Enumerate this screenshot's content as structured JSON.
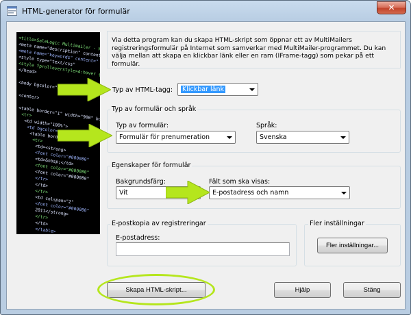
{
  "window": {
    "title": "HTML-generator för formulär",
    "close_label": "✕"
  },
  "side_image": {
    "code_lines": [
      "<title>SaleLogic Multimailer - Newsletter",
      "<meta name=\"description\" content=\"",
      "<meta name=\"keywords\" content=\"",
      "<style type=\"text/css\"",
      "<style fprolloverstyle>A:hover {co",
      "</head>",
      "",
      "<body bgcolor=\"#FFFFFF\" link=\"#",
      "",
      "<center>",
      "",
      "<table border=\"1\" width=\"900\" border",
      "  <tr>",
      "    <td width=\"100%\">",
      "    <td bgcolor=",
      "      <table border",
      "        <tr>",
      "          <td><strong>",
      "          <font color=\"#000080\"",
      "          <td>&nbsp;</td>",
      "          <font color=\"#000080\"",
      "          <font color=\"#000080\"",
      "        </tr>",
      "      </td>",
      "    </tr>",
      "    <td colspan=\"2\"",
      "    <font color=\"#000080\"",
      "    2011</strong>",
      "    </tr>",
      "    </td>",
      "  </table>"
    ]
  },
  "intro": {
    "text": "Via detta program kan du skapa HTML-skript som öppnar ett av MultiMailers registreringsformulär på Internet som samverkar med MultiMailer-programmet. Du kan välja mellan att skapa en klickbar länk eller en ram (IFrame-tagg) som pekar på ett formulär."
  },
  "html_tag": {
    "label": "Typ av HTML-tagg:",
    "value": "Klickbar länk"
  },
  "form_type_group": {
    "title": "Typ av formulär och språk",
    "form_type_label": "Typ av formulär:",
    "form_type_value": "Formulär för prenumeration",
    "language_label": "Språk:",
    "language_value": "Svenska"
  },
  "form_props_group": {
    "title": "Egenskaper för formulär",
    "bgcolor_label": "Bakgrundsfärg:",
    "bgcolor_value": "Vit",
    "fields_label": "Fält som ska visas:",
    "fields_value": "E-postadress och namn"
  },
  "email_copy_group": {
    "title": "E-postkopia av registreringar",
    "email_label": "E-postadress:",
    "email_value": ""
  },
  "more_settings_group": {
    "title": "Fler inställningar",
    "button_label": "Fler inställningar..."
  },
  "buttons": {
    "create_script": "Skapa HTML-skript...",
    "help": "Hjälp",
    "close": "Stäng"
  },
  "colors": {
    "highlight_arrow": "#b5e61d",
    "selection": "#3399ff",
    "dialog_bg": "#f0f0f0"
  }
}
